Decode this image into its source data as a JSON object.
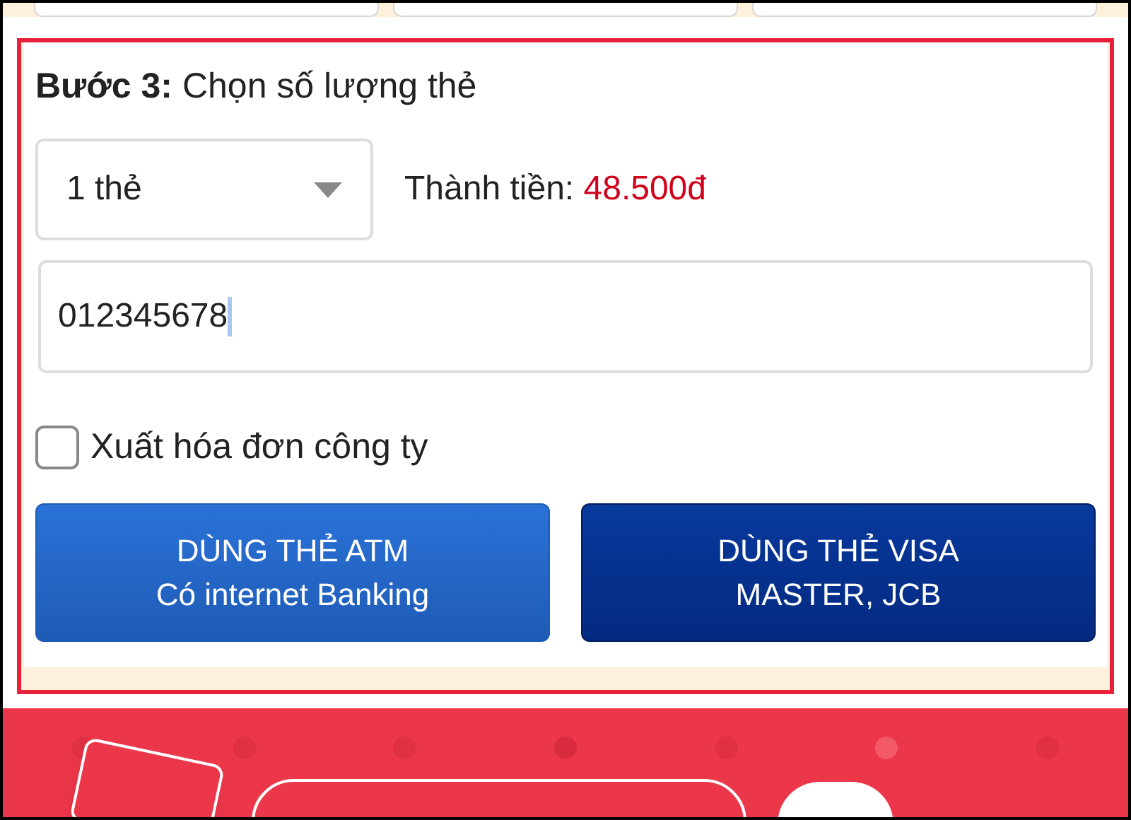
{
  "step": {
    "label": "Bước 3:",
    "text": "Chọn số lượng thẻ"
  },
  "quantity_select": {
    "value": "1 thẻ"
  },
  "total": {
    "label": "Thành tiền:",
    "value": "48.500đ"
  },
  "phone_field": {
    "value": "012345678",
    "focused": true
  },
  "invoice_checkbox": {
    "label": "Xuất hóa đơn công ty",
    "checked": false
  },
  "buttons": [
    {
      "kind": "atm",
      "lines": [
        "DÙNG THẺ ATM",
        "Có internet Banking"
      ]
    },
    {
      "kind": "visa",
      "lines": [
        "DÙNG THẺ VISA",
        "MASTER, JCB"
      ]
    }
  ]
}
